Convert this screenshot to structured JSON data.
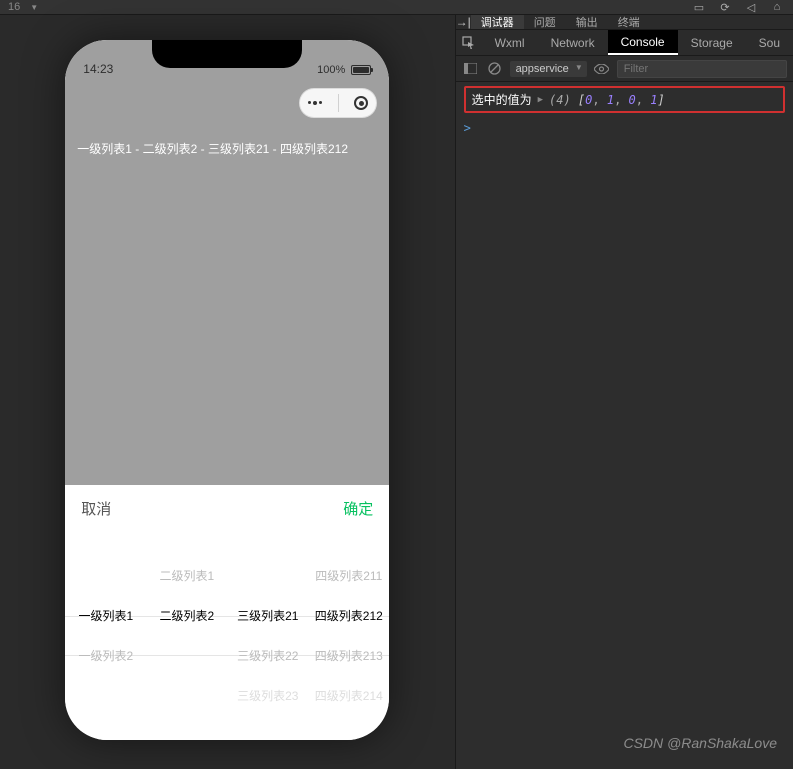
{
  "top_toolbar": {
    "left_label": "16"
  },
  "simulator": {
    "status": {
      "time": "14:23",
      "battery_text": "100%"
    },
    "breadcrumb": "一级列表1 - 二级列表2 - 三级列表21 - 四级列表212",
    "picker": {
      "cancel": "取消",
      "confirm": "确定",
      "columns": [
        {
          "items": [
            "",
            "一级列表1",
            "一级列表2"
          ],
          "selected_index": 1
        },
        {
          "items": [
            "二级列表1",
            "二级列表2",
            ""
          ],
          "selected_index": 1
        },
        {
          "items": [
            "",
            "三级列表21",
            "三级列表22",
            "三级列表23"
          ],
          "selected_index": 1
        },
        {
          "items": [
            "四级列表211",
            "四级列表212",
            "四级列表213",
            "四级列表214"
          ],
          "selected_index": 1
        }
      ]
    }
  },
  "devtools": {
    "top_tabs": [
      "调试器",
      "问题",
      "输出",
      "终端"
    ],
    "active_top_tab": 0,
    "tabs": [
      "Wxml",
      "Network",
      "Console",
      "Storage",
      "Sou"
    ],
    "active_tab": 2,
    "context": "appservice",
    "filter_placeholder": "Filter",
    "console_log": {
      "label": "选中的值为",
      "array_length": "(4)",
      "values": [
        0,
        1,
        0,
        1
      ]
    },
    "prompt": ">"
  },
  "watermark": "CSDN @RanShakaLove"
}
